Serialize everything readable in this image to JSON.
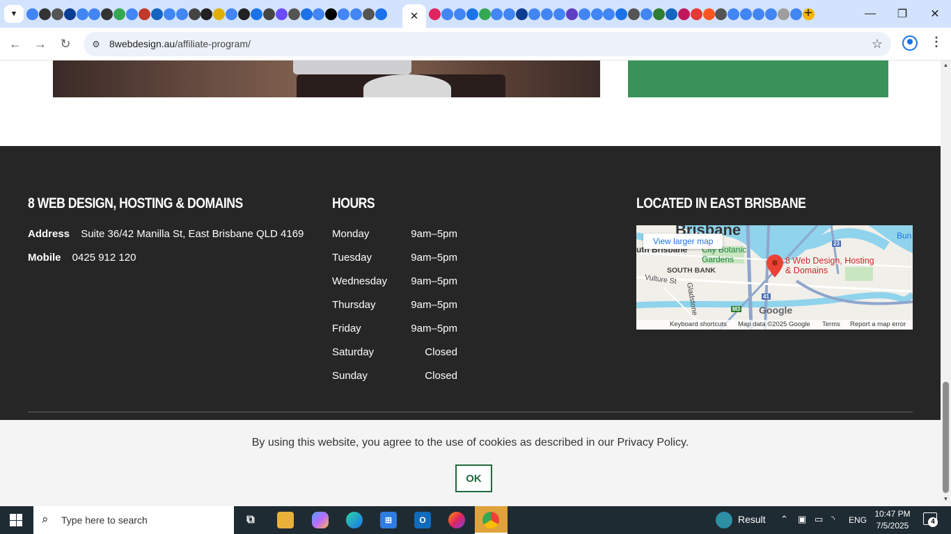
{
  "browser": {
    "active_tab_close": "✕",
    "new_tab": "+",
    "url_host": "8webdesign.au",
    "url_path": "/affiliate-program/"
  },
  "footer": {
    "company": {
      "heading": "8 WEB DESIGN, HOSTING & DOMAINS",
      "address_label": "Address",
      "address_value": "Suite 36/42 Manilla St, East Brisbane QLD 4169",
      "mobile_label": "Mobile",
      "mobile_value": "0425 912 120"
    },
    "hours": {
      "heading": "HOURS",
      "days": [
        {
          "day": "Monday",
          "time": "9am–5pm"
        },
        {
          "day": "Tuesday",
          "time": "9am–5pm"
        },
        {
          "day": "Wednesday",
          "time": "9am–5pm"
        },
        {
          "day": "Thursday",
          "time": "9am–5pm"
        },
        {
          "day": "Friday",
          "time": "9am–5pm"
        },
        {
          "day": "Saturday",
          "time": "Closed"
        },
        {
          "day": "Sunday",
          "time": "Closed"
        }
      ]
    },
    "location": {
      "heading": "LOCATED IN EAST BRISBANE",
      "map": {
        "view_larger": "View larger map",
        "labels": {
          "brisbane": "Brisbane",
          "south_brisbane": "uth Brisbane",
          "botanic": "City Botanic Gardens",
          "south_bank": "SOUTH BANK",
          "vulture": "Vulture St",
          "gladstone": "Gladstone",
          "bun": "Bun",
          "pin": "8 Web Design, Hosting & Domains",
          "road_23": "23",
          "road_41": "41",
          "road_m3": "M3",
          "google": "Google"
        },
        "attribution": {
          "shortcuts": "Keyboard shortcuts",
          "data": "Map data ©2025 Google",
          "terms": "Terms",
          "report": "Report a map error"
        }
      }
    }
  },
  "cookie": {
    "text": "By using this website, you agree to the use of cookies as described in our Privacy Policy.",
    "ok_label": "OK"
  },
  "taskbar": {
    "search_placeholder": "Type here to search",
    "weather_label": "Result",
    "language": "ENG",
    "time": "10:47 PM",
    "date": "7/5/2025",
    "notification_count": "4"
  },
  "colors": {
    "footer_bg": "#262626",
    "accent_green": "#3a9259",
    "ok_border": "#1f6a3c",
    "tabstrip": "#d3e3fd"
  }
}
